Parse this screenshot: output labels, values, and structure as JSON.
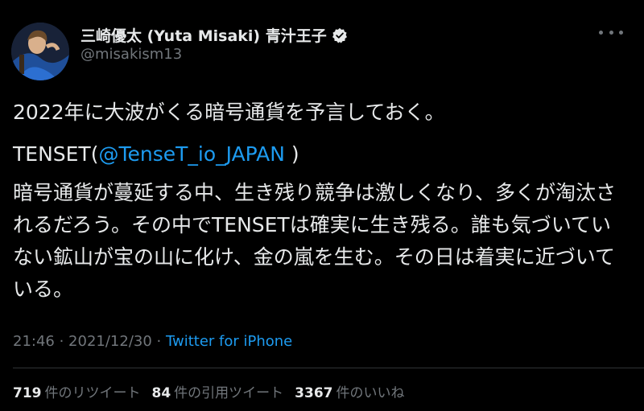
{
  "header": {
    "display_name": "三崎優太 (Yuta Misaki) 青汁王子",
    "handle": "@misakism13",
    "verified_icon": "verified-badge-icon",
    "more_icon": "more-options-icon"
  },
  "content": {
    "line1": "2022年に大波がくる暗号通貨を予言しておく。",
    "line2_prefix": "TENSET(",
    "line2_mention": "@TenseT_io_JAPAN",
    "line2_suffix": " )",
    "paragraph": "暗号通貨が蔓延する中、生き残り競争は激しくなり、多くが淘汰されるだろう。その中でTENSETは確実に生き残る。誰も気づいていない鉱山が宝の山に化け、金の嵐を生む。その日は着実に近づいている。"
  },
  "meta": {
    "time": "21:46",
    "date": "2021/12/30",
    "separator": " · ",
    "source": "Twitter for iPhone"
  },
  "stats": {
    "retweets_count": "719",
    "retweets_label": "件のリツイート",
    "quotes_count": "84",
    "quotes_label": "件の引用ツイート",
    "likes_count": "3367",
    "likes_label": "件のいいね"
  },
  "colors": {
    "background": "#000000",
    "text": "#e7e9ea",
    "secondary": "#71767b",
    "link": "#1d9bf0"
  }
}
